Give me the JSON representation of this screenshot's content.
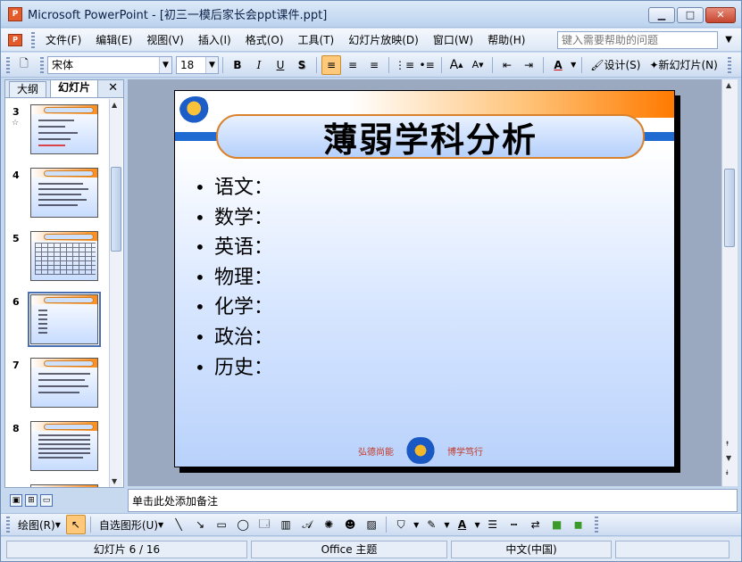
{
  "window": {
    "title": "Microsoft PowerPoint - [初三一模后家长会ppt课件.ppt]",
    "app_icon": "P"
  },
  "menu": {
    "items": [
      "文件(F)",
      "编辑(E)",
      "视图(V)",
      "插入(I)",
      "格式(O)",
      "工具(T)",
      "幻灯片放映(D)",
      "窗口(W)",
      "帮助(H)"
    ],
    "help_placeholder": "键入需要帮助的问题"
  },
  "toolbar": {
    "font": "宋体",
    "size": "18",
    "bold": "B",
    "italic": "I",
    "underline": "U",
    "shadow": "S",
    "design": "设计(S)",
    "new_slide": "新幻灯片(N)"
  },
  "leftpane": {
    "tabs": [
      "大纲",
      "幻灯片"
    ],
    "slide_numbers": [
      "3",
      "4",
      "5",
      "6",
      "7",
      "8",
      "9"
    ],
    "selected": "6"
  },
  "slide": {
    "title": "薄弱学科分析",
    "bullets": [
      "语文：",
      "数学：",
      "英语：",
      "物理：",
      "化学：",
      "政治：",
      "历史："
    ],
    "footer_left": "弘德尚能",
    "footer_right": "博学笃行"
  },
  "notes": {
    "placeholder": "单击此处添加备注"
  },
  "drawbar": {
    "draw": "绘图(R)",
    "autoshapes": "自选图形(U)"
  },
  "status": {
    "slide": "幻灯片 6 / 16",
    "theme": "Office 主题",
    "language": "中文(中国)"
  },
  "colors": {
    "accent": "#ff7a00",
    "blue": "#1f6bd1",
    "selection": "#ffc87a"
  }
}
